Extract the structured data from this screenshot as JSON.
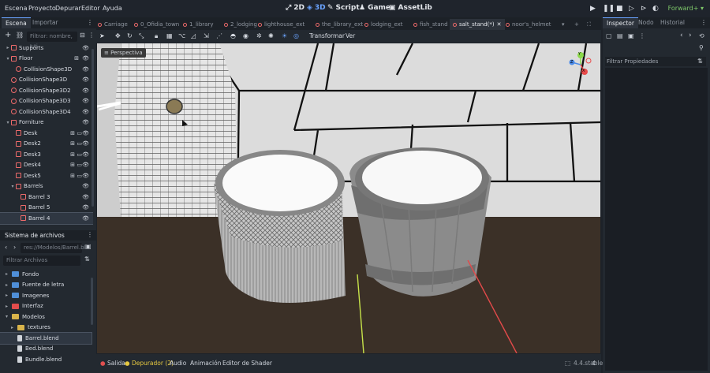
{
  "menu": [
    "Escena",
    "Proyecto",
    "Depurar",
    "Editor",
    "Ayuda"
  ],
  "workspaces": [
    {
      "label": "2D",
      "icon": "2d-icon",
      "active": false
    },
    {
      "label": "3D",
      "icon": "3d-icon",
      "active": true
    },
    {
      "label": "Script",
      "icon": "script-icon",
      "active": false
    },
    {
      "label": "Game",
      "icon": "game-icon",
      "active": false
    },
    {
      "label": "AssetLib",
      "icon": "assetlib-icon",
      "active": false
    }
  ],
  "renderer": "Forward+",
  "scene_dock": {
    "tabs": [
      "Escena",
      "Importar"
    ],
    "filter_placeholder": "Filtrar: nombre, t:ti",
    "tree": [
      {
        "label": "Supports",
        "indent": 1,
        "icon": "node3d",
        "arrow": "▸"
      },
      {
        "label": "Floor",
        "indent": 1,
        "icon": "node3d",
        "arrow": "▾",
        "extra": true
      },
      {
        "label": "CollisionShape3D",
        "indent": 2,
        "icon": "collision",
        "arrow": ""
      },
      {
        "label": "CollisionShape3D",
        "indent": 1,
        "icon": "collision",
        "arrow": ""
      },
      {
        "label": "CollisionShape3D2",
        "indent": 1,
        "icon": "collision",
        "arrow": ""
      },
      {
        "label": "CollisionShape3D3",
        "indent": 1,
        "icon": "collision",
        "arrow": ""
      },
      {
        "label": "CollisionShape3D4",
        "indent": 1,
        "icon": "collision",
        "arrow": ""
      },
      {
        "label": "Forniture",
        "indent": 1,
        "icon": "node3d",
        "arrow": "▾"
      },
      {
        "label": "Desk",
        "indent": 2,
        "icon": "node3d",
        "arrow": "",
        "extra2": true
      },
      {
        "label": "Desk2",
        "indent": 2,
        "icon": "node3d",
        "arrow": "",
        "extra2": true
      },
      {
        "label": "Desk3",
        "indent": 2,
        "icon": "node3d",
        "arrow": "",
        "extra2": true
      },
      {
        "label": "Desk4",
        "indent": 2,
        "icon": "node3d",
        "arrow": "",
        "extra2": true
      },
      {
        "label": "Desk5",
        "indent": 2,
        "icon": "node3d",
        "arrow": "",
        "extra2": true
      },
      {
        "label": "Barrels",
        "indent": 2,
        "icon": "node3d",
        "arrow": "▾"
      },
      {
        "label": "Barrel 3",
        "indent": 3,
        "icon": "mesh",
        "arrow": ""
      },
      {
        "label": "Barrel 5",
        "indent": 3,
        "icon": "mesh",
        "arrow": ""
      },
      {
        "label": "Barrel 4",
        "indent": 3,
        "icon": "mesh",
        "arrow": "",
        "selected": true
      }
    ]
  },
  "filesystem": {
    "title": "Sistema de archivos",
    "path": "res://Modelos/Barrel.bl",
    "filter_placeholder": "Filtrar Archivos",
    "items": [
      {
        "label": "Fondo",
        "indent": 1,
        "type": "folder",
        "color": "#4f8fd8",
        "arrow": "▸"
      },
      {
        "label": "Fuente de letra",
        "indent": 1,
        "type": "folder",
        "color": "#4f8fd8",
        "arrow": "▸"
      },
      {
        "label": "Imagenes",
        "indent": 1,
        "type": "folder",
        "color": "#4f8fd8",
        "arrow": "▸"
      },
      {
        "label": "Interfaz",
        "indent": 1,
        "type": "folder",
        "color": "#e24c4c",
        "arrow": "▸"
      },
      {
        "label": "Modelos",
        "indent": 1,
        "type": "folder",
        "color": "#d8b34a",
        "arrow": "▾"
      },
      {
        "label": "textures",
        "indent": 2,
        "type": "folder",
        "color": "#d8b34a",
        "arrow": "▸"
      },
      {
        "label": "Barrel.blend",
        "indent": 2,
        "type": "file",
        "selected": true
      },
      {
        "label": "Bed.blend",
        "indent": 2,
        "type": "file"
      },
      {
        "label": "Bundle.blend",
        "indent": 2,
        "type": "file"
      }
    ]
  },
  "scene_tabs": [
    {
      "label": "Carriage",
      "active": false
    },
    {
      "label": "0_Ofidia_town",
      "active": false
    },
    {
      "label": "1_library",
      "active": false
    },
    {
      "label": "2_lodging",
      "active": false
    },
    {
      "label": "lighthouse_ext",
      "active": false
    },
    {
      "label": "the_library_ext",
      "active": false
    },
    {
      "label": "lodging_ext",
      "active": false
    },
    {
      "label": "fish_stand",
      "active": false
    },
    {
      "label": "salt_stand(*)",
      "active": true
    },
    {
      "label": "noor's_helmet",
      "active": false
    }
  ],
  "toolbar": {
    "transform": "Transformar",
    "view": "Ver"
  },
  "viewport": {
    "perspective_label": "Perspectiva",
    "gizmo": {
      "x": "X",
      "y": "Y",
      "z": "Z"
    }
  },
  "bottom_tabs": [
    {
      "label": "Salida",
      "dot": "#e05050"
    },
    {
      "label": "Depurador (2)",
      "dot": "#e6c840",
      "highlight": true
    },
    {
      "label": "Audio"
    },
    {
      "label": "Animación"
    },
    {
      "label": "Editor de Shader"
    }
  ],
  "version": "4.4.stable",
  "inspector": {
    "tabs": [
      "Inspector",
      "Nodo",
      "Historial"
    ],
    "filter_label": "Filtrar Propiedades"
  },
  "colors": {
    "accent": "#6aa3ff",
    "node_red": "#ef6b6b",
    "renderer_green": "#7ec86a"
  }
}
